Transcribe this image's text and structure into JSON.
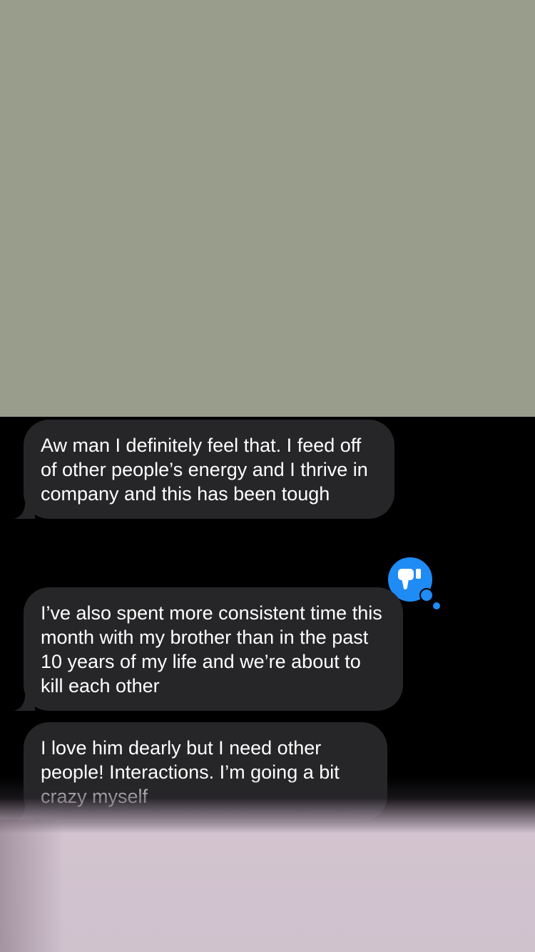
{
  "colors": {
    "top_panel": "#989e8b",
    "background": "#000000",
    "incoming_bubble": "#262628",
    "reaction_badge": "#1f8bf5",
    "bottom_overlay": "#d2c3cf"
  },
  "messages": [
    {
      "text": "Aw man I definitely feel that. I feed off of other people’s energy and I thrive in company and this has been tough"
    },
    {
      "text": "I’ve also spent more consistent time this month with my brother than in the past 10 years of my life and we’re about to kill each other",
      "reaction": "thumbs-down-icon"
    },
    {
      "text": "I love him dearly but I need other people! Interactions. I’m going a bit crazy myself"
    }
  ]
}
